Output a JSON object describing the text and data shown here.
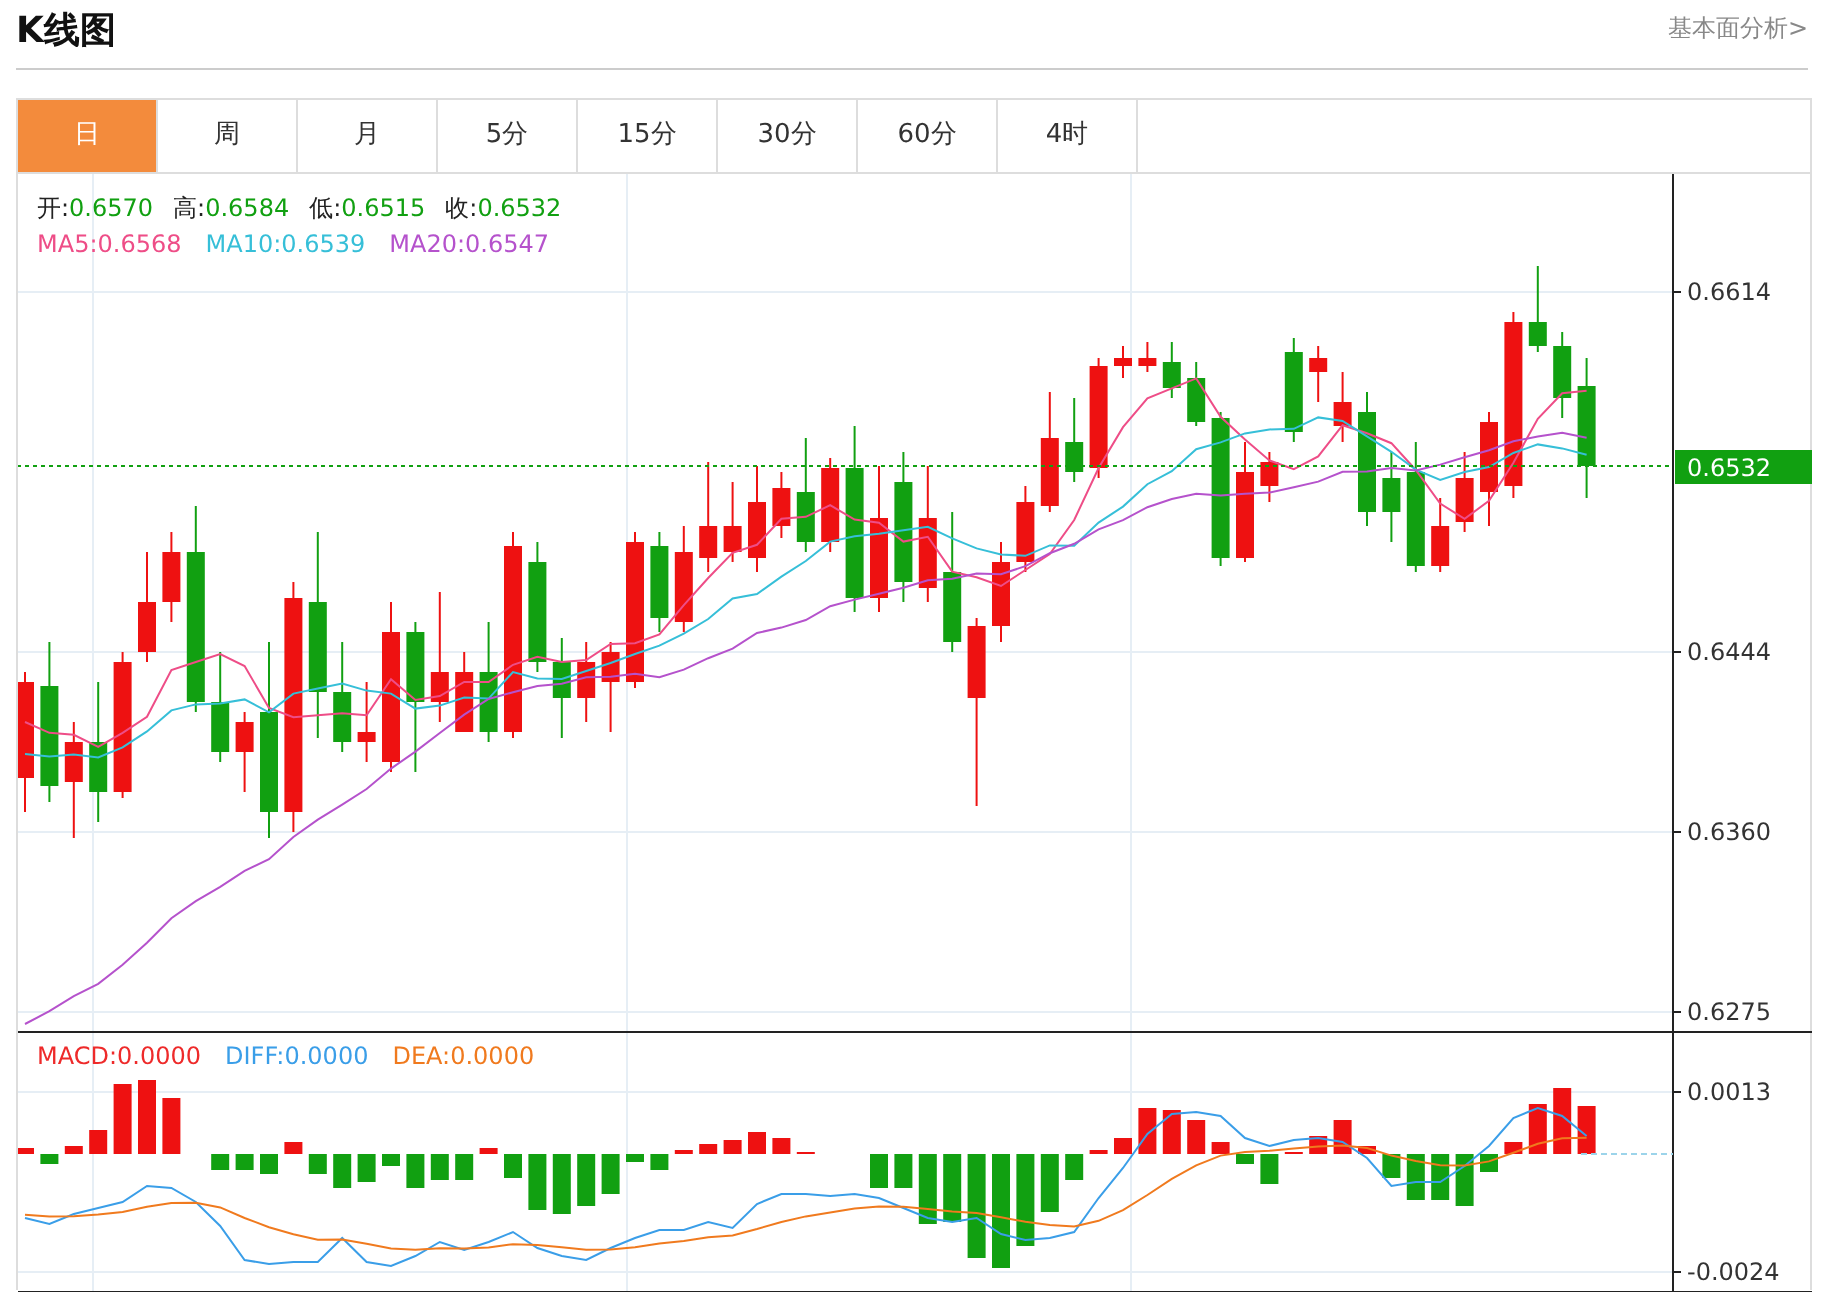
{
  "header": {
    "title": "K线图",
    "link": "基本面分析>"
  },
  "tabs": [
    {
      "label": "日",
      "selected": true
    },
    {
      "label": "周",
      "selected": false
    },
    {
      "label": "月",
      "selected": false
    },
    {
      "label": "5分",
      "selected": false
    },
    {
      "label": "15分",
      "selected": false
    },
    {
      "label": "30分",
      "selected": false
    },
    {
      "label": "60分",
      "selected": false
    },
    {
      "label": "4时",
      "selected": false
    }
  ],
  "quote": [
    {
      "label": "开:",
      "value": "0.6570"
    },
    {
      "label": "高:",
      "value": "0.6584"
    },
    {
      "label": "低:",
      "value": "0.6515"
    },
    {
      "label": "收:",
      "value": "0.6532"
    }
  ],
  "moving_averages": [
    {
      "label": "MA5:",
      "value": "0.6568",
      "color": "#ee4d87"
    },
    {
      "label": "MA10:",
      "value": "0.6539",
      "color": "#36bfd8"
    },
    {
      "label": "MA20:",
      "value": "0.6547",
      "color": "#b552cc"
    }
  ],
  "price_axis": {
    "labels": [
      "0.6614",
      "0.6444",
      "0.6360",
      "0.6275"
    ],
    "current_price": "0.6532"
  },
  "macd_legend": [
    {
      "label": "MACD:",
      "value": "0.0000",
      "color": "#ee2a2a"
    },
    {
      "label": "DIFF:",
      "value": "0.0000",
      "color": "#3a9ee8"
    },
    {
      "label": "DEA:",
      "value": "0.0000",
      "color": "#f07a1e"
    }
  ],
  "macd_axis": {
    "labels": [
      "0.0013",
      "-0.0024"
    ]
  }
}
